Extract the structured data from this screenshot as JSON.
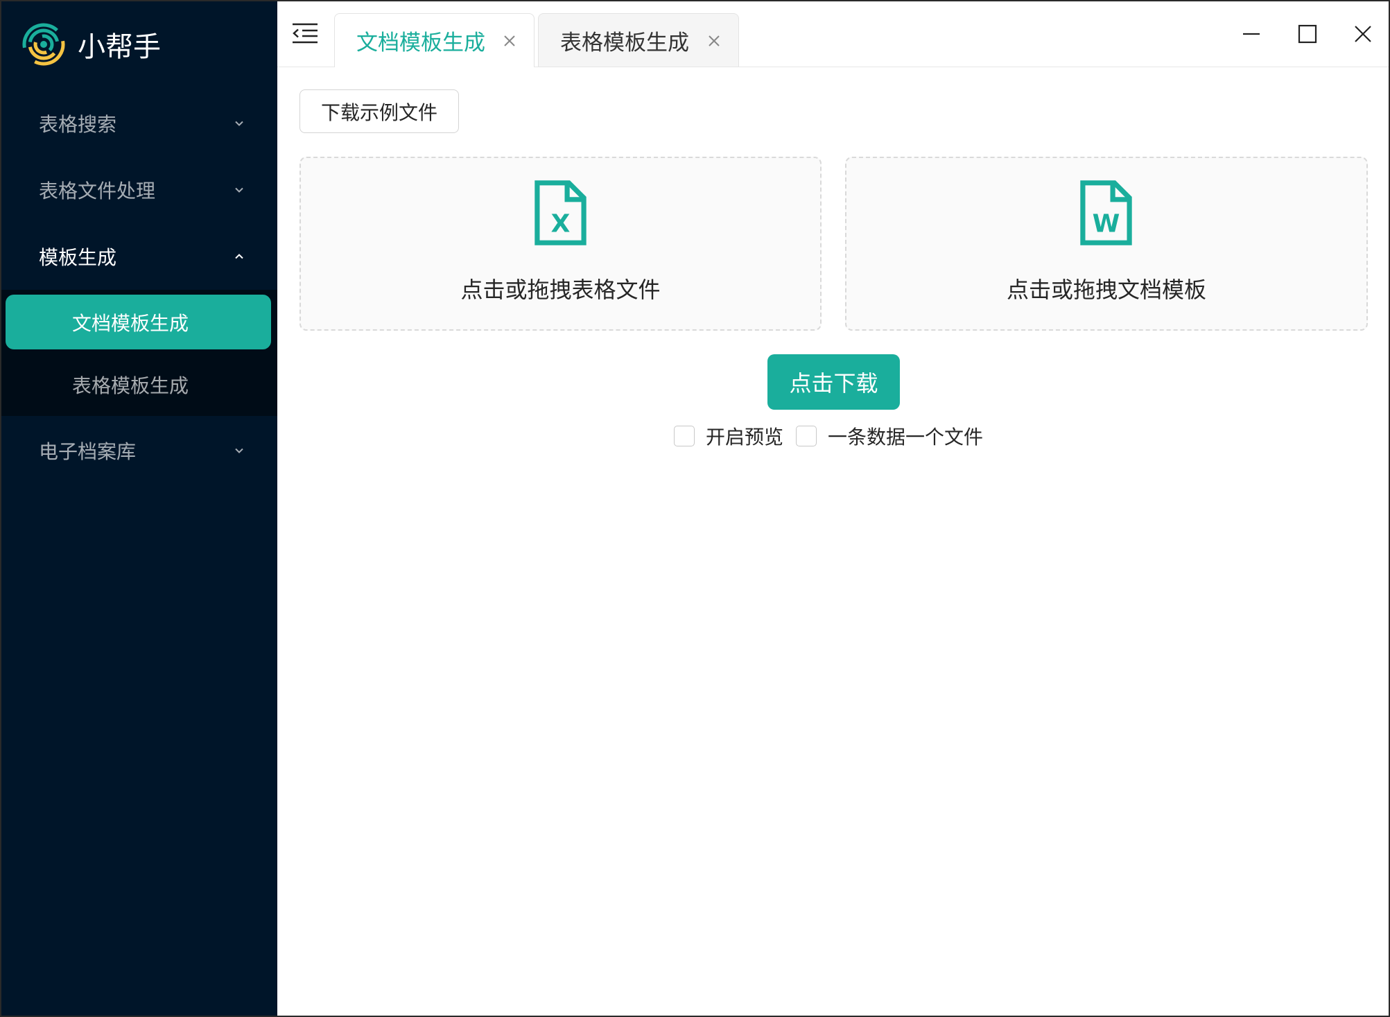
{
  "app": {
    "title": "小帮手",
    "logo_icon": "app-logo-icon"
  },
  "sidebar": {
    "items": [
      {
        "label": "表格搜索",
        "icon": "chevron-down-icon",
        "expanded": false
      },
      {
        "label": "表格文件处理",
        "icon": "chevron-down-icon",
        "expanded": false
      },
      {
        "label": "模板生成",
        "icon": "chevron-up-icon",
        "expanded": true,
        "children": [
          {
            "label": "文档模板生成",
            "active": true
          },
          {
            "label": "表格模板生成",
            "active": false
          }
        ]
      },
      {
        "label": "电子档案库",
        "icon": "chevron-down-icon",
        "expanded": false
      }
    ]
  },
  "toolbar": {
    "collapse_icon": "menu-fold-icon"
  },
  "tabs": [
    {
      "label": "文档模板生成",
      "active": true,
      "close_icon": "close-icon"
    },
    {
      "label": "表格模板生成",
      "active": false,
      "close_icon": "close-icon"
    }
  ],
  "window_controls": {
    "minimize_icon": "minimize-icon",
    "maximize_icon": "maximize-icon",
    "close_icon": "close-icon"
  },
  "main": {
    "sample_button_label": "下载示例文件",
    "dropzones": [
      {
        "label": "点击或拖拽表格文件",
        "icon": "excel-file-icon",
        "icon_letter": "X"
      },
      {
        "label": "点击或拖拽文档模板",
        "icon": "word-file-icon",
        "icon_letter": "W"
      }
    ],
    "download_button_label": "点击下载",
    "options": [
      {
        "label": "开启预览",
        "checked": false
      },
      {
        "label": "一条数据一个文件",
        "checked": false
      }
    ]
  },
  "colors": {
    "accent": "#1aae9c",
    "sidebar_bg": "#001529",
    "submenu_bg": "#000c17",
    "logo_yellow": "#f5c342"
  }
}
